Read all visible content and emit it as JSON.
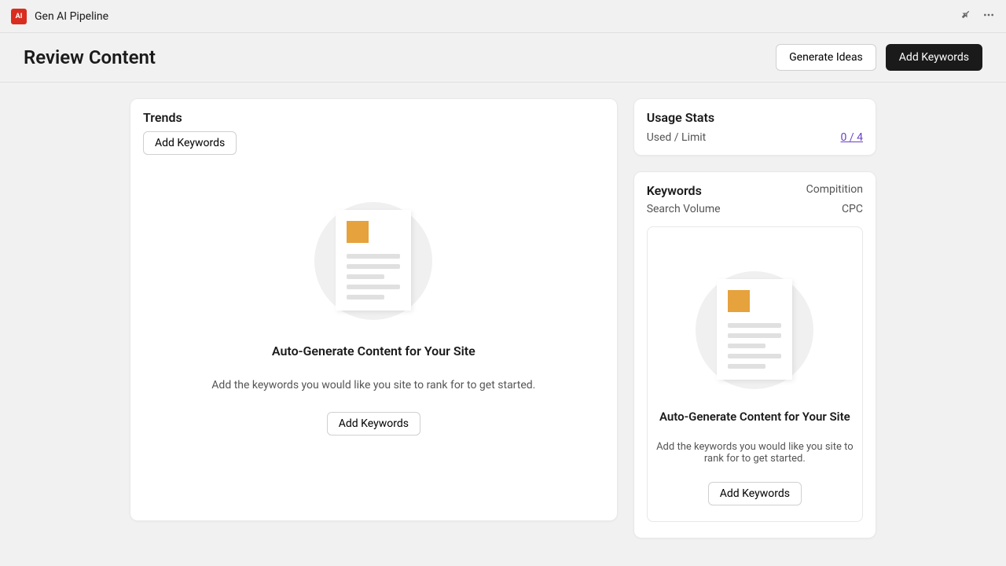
{
  "topbar": {
    "app_title": "Gen AI Pipeline"
  },
  "header": {
    "page_title": "Review Content",
    "generate_ideas_label": "Generate Ideas",
    "add_keywords_label": "Add Keywords"
  },
  "trends": {
    "title": "Trends",
    "add_keywords_label": "Add Keywords",
    "empty_title": "Auto-Generate Content for Your Site",
    "empty_desc": "Add the keywords you would like you site to rank for to get started.",
    "empty_cta": "Add Keywords"
  },
  "usage": {
    "title": "Usage Stats",
    "label": "Used / Limit",
    "value": "0 / 4"
  },
  "keywords": {
    "title": "Keywords",
    "col_competition": "Compitition",
    "col_search_volume": "Search Volume",
    "col_cpc": "CPC",
    "empty_title": "Auto-Generate Content for Your Site",
    "empty_desc": "Add the keywords you would like you site to rank for to get started.",
    "empty_cta": "Add Keywords"
  }
}
